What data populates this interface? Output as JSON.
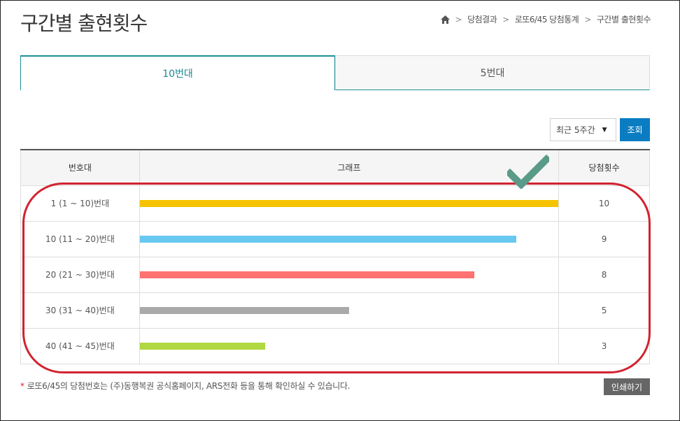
{
  "page": {
    "title": "구간별 출현횟수"
  },
  "breadcrumb": {
    "home": "home-icon",
    "items": [
      "당첨결과",
      "로또6/45 당첨통계",
      "구간별 출현횟수"
    ],
    "separator": ">"
  },
  "tabs": [
    {
      "label": "10번대",
      "active": true
    },
    {
      "label": "5번대",
      "active": false
    }
  ],
  "filter": {
    "selected": "최근 5주간",
    "search_label": "조회"
  },
  "table": {
    "headers": [
      "번호대",
      "그래프",
      "당첨횟수"
    ],
    "rows": [
      {
        "range": "1 (1 ~ 10)번대",
        "count": "10",
        "value": 10,
        "color": "#f5c300"
      },
      {
        "range": "10 (11 ~ 20)번대",
        "count": "9",
        "value": 9,
        "color": "#69c8f2"
      },
      {
        "range": "20 (21 ~ 30)번대",
        "count": "8",
        "value": 8,
        "color": "#ff7272"
      },
      {
        "range": "30 (31 ~ 40)번대",
        "count": "5",
        "value": 5,
        "color": "#aaaaaa"
      },
      {
        "range": "40 (41 ~ 45)번대",
        "count": "3",
        "value": 3,
        "color": "#b0d840"
      }
    ]
  },
  "chart_data": {
    "type": "bar",
    "categories": [
      "1 (1 ~ 10)번대",
      "10 (11 ~ 20)번대",
      "20 (21 ~ 30)번대",
      "30 (31 ~ 40)번대",
      "40 (41 ~ 45)번대"
    ],
    "values": [
      10,
      9,
      8,
      5,
      3
    ],
    "xlabel": "",
    "ylabel": "",
    "xlim": [
      0,
      10
    ]
  },
  "annotations": {
    "highlight_color": "#d2232f",
    "check_color": "#5a9a88",
    "check_icon": "check-icon"
  },
  "footer": {
    "note_marker": "*",
    "note": "로또6/45의 당첨번호는 (주)동행복권 공식홈페이지, ARS전화 등을 통해 확인하실 수 있습니다.",
    "print_label": "인쇄하기"
  }
}
